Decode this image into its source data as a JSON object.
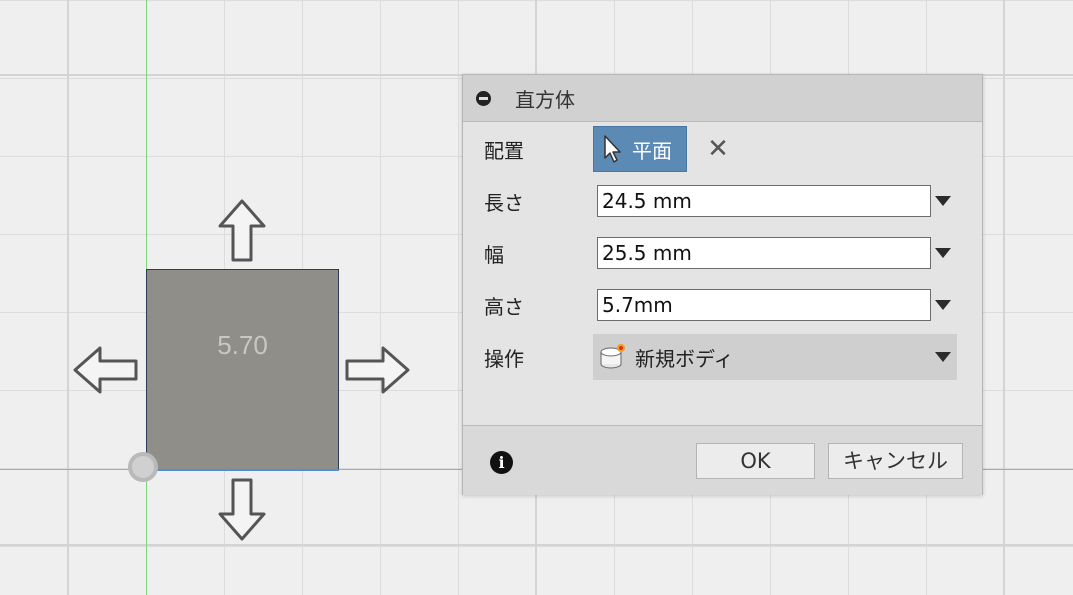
{
  "viewport": {
    "dimension_label": "5.70",
    "colors": {
      "axis_y": "#7fd47f",
      "axis_x": "#e88e8e",
      "body_fill": "#8f8e88",
      "selected_edge": "#4d8fd8"
    }
  },
  "dialog": {
    "title": "直方体",
    "rows": {
      "placement": {
        "label": "配置",
        "value": "平面"
      },
      "length": {
        "label": "長さ",
        "value": "24.5 mm"
      },
      "width": {
        "label": "幅",
        "value": "25.5 mm"
      },
      "height": {
        "label": "高さ",
        "value": "5.7mm"
      },
      "operation": {
        "label": "操作",
        "value": "新規ボディ"
      }
    },
    "clear_glyph": "✕",
    "info_glyph": "i",
    "ok_label": "OK",
    "cancel_label": "キャンセル",
    "accent_color": "#5b8bb5",
    "icons": [
      "collapse-icon",
      "cursor-icon",
      "close-icon",
      "dropdown-arrow-icon",
      "new-body-icon",
      "info-icon"
    ]
  }
}
